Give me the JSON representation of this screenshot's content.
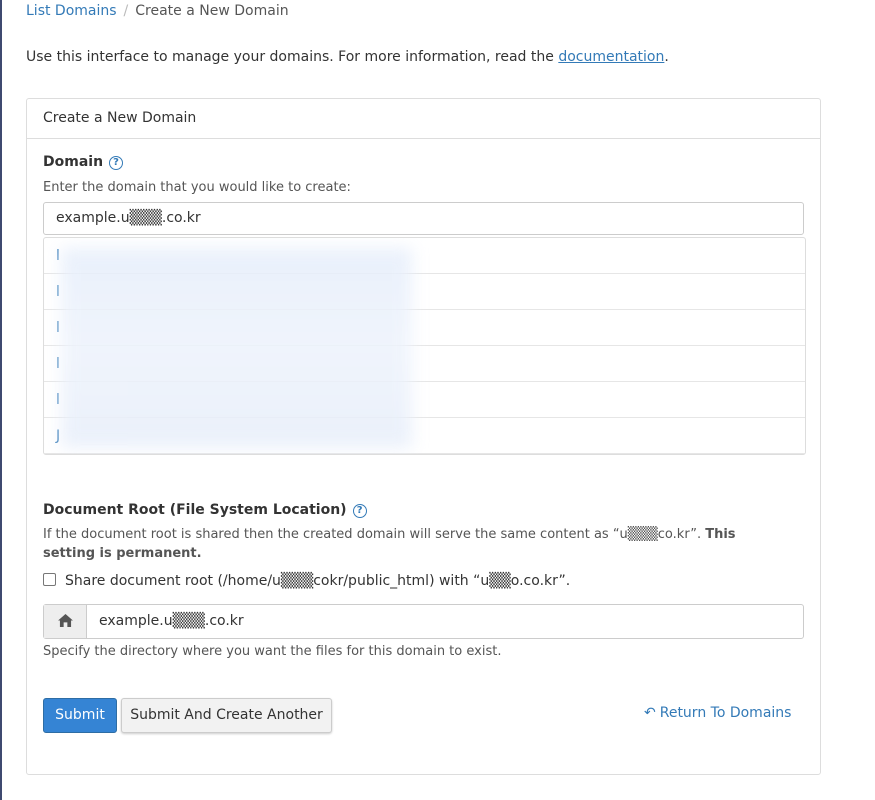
{
  "breadcrumb": {
    "parent": "List Domains",
    "current": "Create a New Domain"
  },
  "intro": {
    "text": "Use this interface to manage your domains. For more information, read the ",
    "link": "documentation",
    "end": "."
  },
  "panel": {
    "heading": "Create a New Domain",
    "domain": {
      "label": "Domain",
      "hint": "Enter the domain that you would like to create:",
      "value": "example.u▒▒▒.co.kr"
    },
    "suggestions": [
      "l",
      "l",
      "l",
      "l",
      "l",
      "J"
    ],
    "docroot": {
      "label": "Document Root (File System Location)",
      "warning_start": "If the document root is shared then the created domain will serve the same content as “u▒▒▒co.kr”. ",
      "warning_bold": "This setting is permanent.",
      "share_label": "Share document root (/home/u▒▒▒cokr/public_html) with “u▒▒o.co.kr”.",
      "value": "example.u▒▒▒.co.kr",
      "hint": "Specify the directory where you want the files for this domain to exist."
    },
    "buttons": {
      "submit": "Submit",
      "submit_another": "Submit And Create Another",
      "return": "Return To Domains"
    }
  },
  "icons": {
    "help": "question-circle-icon",
    "home": "home-icon",
    "return": "reply-arrow-icon"
  },
  "colors": {
    "link": "#337ab7",
    "primary": "#3584d4"
  }
}
